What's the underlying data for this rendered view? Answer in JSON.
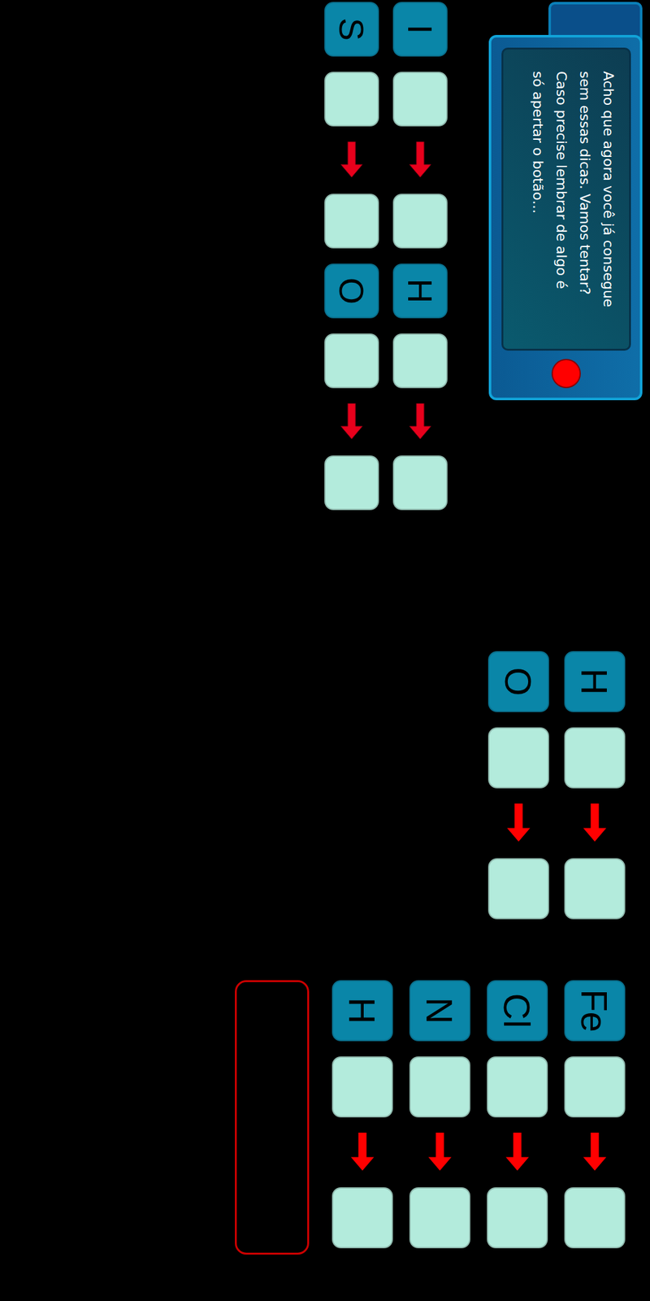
{
  "dialog": {
    "lines": [
      "Acho que agora você já consegue",
      "sem essas dicas. Vamos tentar?",
      "Caso precise lembrar de algo é",
      "só apertar o botão..."
    ]
  },
  "groups": [
    {
      "size": "small",
      "rows": [
        {
          "symbols": [
            "I",
            "H"
          ]
        },
        {
          "symbols": [
            "S",
            "O"
          ]
        }
      ],
      "answer_box": false
    },
    {
      "size": "large",
      "rows": [
        {
          "symbols": [
            "H"
          ]
        },
        {
          "symbols": [
            "O"
          ]
        }
      ],
      "answer_box": false
    },
    {
      "size": "large",
      "rows": [
        {
          "symbols": [
            "Fe"
          ]
        },
        {
          "symbols": [
            "Cl"
          ]
        },
        {
          "symbols": [
            "N"
          ]
        },
        {
          "symbols": [
            "H"
          ]
        }
      ],
      "answer_box": true
    }
  ]
}
